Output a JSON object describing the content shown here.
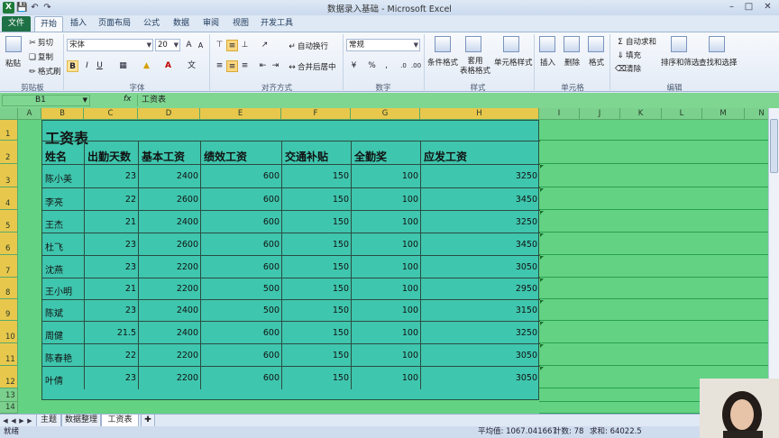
{
  "window": {
    "title": "数据录入基础 - Microsoft Excel",
    "app_icon": "X"
  },
  "quick_access": [
    "save-icon",
    "undo-icon",
    "redo-icon"
  ],
  "ribbon_tabs": [
    "文件",
    "开始",
    "插入",
    "页面布局",
    "公式",
    "数据",
    "审阅",
    "视图",
    "开发工具"
  ],
  "ribbon": {
    "clipboard": {
      "paste": "粘贴",
      "cut": "剪切",
      "copy": "复制",
      "format_painter": "格式刷",
      "label": "剪贴板"
    },
    "font": {
      "name": "宋体",
      "size": "20",
      "bold": "B",
      "italic": "I",
      "underline": "U",
      "label": "字体"
    },
    "alignment": {
      "wrap": "自动换行",
      "merge": "合并后居中",
      "label": "对齐方式"
    },
    "number": {
      "format": "常规",
      "percent": "%",
      "label": "数字"
    },
    "styles": {
      "conditional": "条件格式",
      "table": "套用\n表格格式",
      "cell_styles": "单元格样式",
      "label": "样式"
    },
    "cells": {
      "insert": "插入",
      "delete": "删除",
      "format": "格式",
      "label": "单元格"
    },
    "editing": {
      "autosum": "自动求和",
      "fill": "填充",
      "clear": "清除",
      "sort": "排序和筛选",
      "find": "查找和选择",
      "label": "编辑"
    }
  },
  "formula_bar": {
    "name_box": "B1",
    "fx": "fx",
    "formula": "工资表"
  },
  "columns": [
    "A",
    "B",
    "C",
    "D",
    "E",
    "F",
    "G",
    "H",
    "I",
    "J",
    "K",
    "L",
    "M",
    "N"
  ],
  "rows": [
    "1",
    "2",
    "3",
    "4",
    "5",
    "6",
    "7",
    "8",
    "9",
    "10",
    "11",
    "12",
    "13",
    "14"
  ],
  "table": {
    "title": "工资表",
    "headers": [
      "姓名",
      "出勤天数",
      "基本工资",
      "绩效工资",
      "交通补贴",
      "全勤奖",
      "应发工资"
    ],
    "rows": [
      [
        "陈小美",
        "23",
        "2400",
        "600",
        "150",
        "100",
        "3250"
      ],
      [
        "李亮",
        "22",
        "2600",
        "600",
        "150",
        "100",
        "3450"
      ],
      [
        "王杰",
        "21",
        "2400",
        "600",
        "150",
        "100",
        "3250"
      ],
      [
        "杜飞",
        "23",
        "2600",
        "600",
        "150",
        "100",
        "3450"
      ],
      [
        "沈燕",
        "23",
        "2200",
        "600",
        "150",
        "100",
        "3050"
      ],
      [
        "王小明",
        "21",
        "2200",
        "500",
        "150",
        "100",
        "2950"
      ],
      [
        "陈斌",
        "23",
        "2400",
        "500",
        "150",
        "100",
        "3150"
      ],
      [
        "周健",
        "21.5",
        "2400",
        "600",
        "150",
        "100",
        "3250"
      ],
      [
        "陈春艳",
        "22",
        "2200",
        "600",
        "150",
        "100",
        "3050"
      ],
      [
        "叶倩",
        "23",
        "2200",
        "600",
        "150",
        "100",
        "3050"
      ]
    ]
  },
  "sheet_tabs": [
    "主题",
    "数据整理",
    "工资表"
  ],
  "status": {
    "ready": "就绪",
    "average": "平均值: 1067.041667",
    "count": "计数: 78",
    "sum": "求和: 64022.5"
  },
  "colors": {
    "sheet_bg": "#63d283",
    "table_bg": "#3fc6ae",
    "selection": "#e8c84c",
    "file_tab": "#1e7145"
  }
}
